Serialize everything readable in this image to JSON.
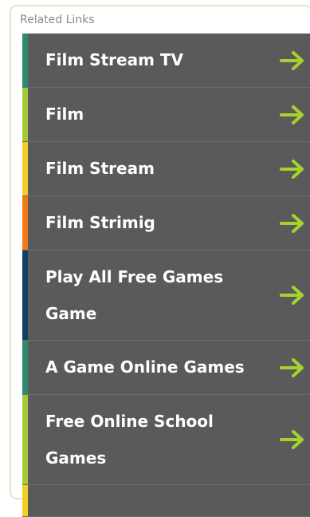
{
  "panel": {
    "title": "Related Links"
  },
  "links": [
    {
      "label": "Film Stream TV",
      "stripe": "#2e8b6e"
    },
    {
      "label": "Film",
      "stripe": "#a6c93a"
    },
    {
      "label": "Film Stream",
      "stripe": "#f2cf25"
    },
    {
      "label": "Film Strimig",
      "stripe": "#ef7a1a"
    },
    {
      "label": "Play All Free Games Game",
      "stripe": "#12405e"
    },
    {
      "label": "A Game Online Games",
      "stripe": "#2e8b6e"
    },
    {
      "label": "Free Online School Games",
      "stripe": "#a6c93a"
    }
  ],
  "colors": {
    "arrow": "#a6d22e",
    "item_bg": "#5a5a5a",
    "panel_border": "#dcebc6"
  },
  "icons": {
    "arrow": "arrow-right-icon"
  }
}
